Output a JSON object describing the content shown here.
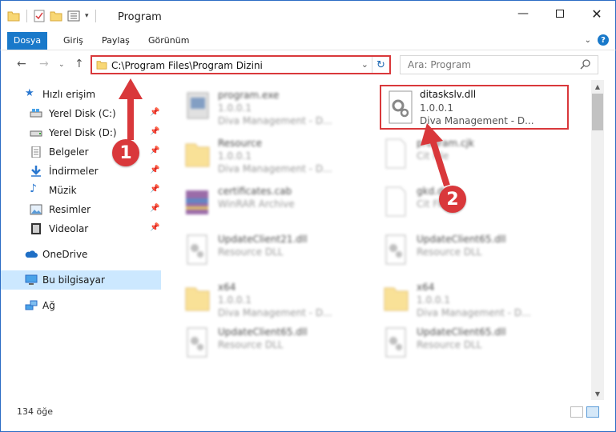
{
  "window": {
    "title": "Program",
    "minimize_icon": "minimize-icon",
    "maximize_icon": "maximize-icon",
    "close_icon": "close-icon"
  },
  "ribbon": {
    "tabs": [
      "Dosya",
      "Giriş",
      "Paylaş",
      "Görünüm"
    ],
    "file_tab_color": "#1979ca"
  },
  "address": {
    "path": "C:\\Program Files\\Program Dizini"
  },
  "search": {
    "placeholder": "Ara: Program"
  },
  "sidebar": {
    "items": [
      {
        "label": "Hızlı erişim",
        "icon": "star-icon",
        "pinned": false
      },
      {
        "label": "Yerel Disk (C:)",
        "icon": "drive-icon",
        "pinned": true
      },
      {
        "label": "Yerel Disk (D:)",
        "icon": "drive-icon",
        "pinned": true
      },
      {
        "label": "Belgeler",
        "icon": "document-icon",
        "pinned": true
      },
      {
        "label": "İndirmeler",
        "icon": "download-icon",
        "pinned": true
      },
      {
        "label": "Müzik",
        "icon": "music-icon",
        "pinned": true
      },
      {
        "label": "Resimler",
        "icon": "pictures-icon",
        "pinned": true
      },
      {
        "label": "Videolar",
        "icon": "video-icon",
        "pinned": true
      },
      {
        "label": "OneDrive",
        "icon": "cloud-icon",
        "pinned": false
      },
      {
        "label": "Bu bilgisayar",
        "icon": "computer-icon",
        "pinned": false,
        "selected": true
      },
      {
        "label": "Ağ",
        "icon": "network-icon",
        "pinned": false
      }
    ]
  },
  "files": [
    {
      "name": "program.exe",
      "line1": "1.0.0.1",
      "line2": "Diva Management - D...",
      "icon": "exe-icon"
    },
    {
      "name": "ditaskslv.dll",
      "line1": "1.0.0.1",
      "line2": "Diva Management - D...",
      "icon": "dll-gear-icon",
      "highlighted": true
    },
    {
      "name": "Resource",
      "line1": "1.0.0.1",
      "line2": "Diva Management - D...",
      "icon": "folder-icon"
    },
    {
      "name": "program.cjk",
      "line1": "Cit File",
      "line2": "",
      "icon": "blank-file-icon"
    },
    {
      "name": "certificates.cab",
      "line1": "WinRAR Archive",
      "line2": "",
      "icon": "archive-icon"
    },
    {
      "name": "gkd.dat",
      "line1": "Cit File",
      "line2": "",
      "icon": "blank-file-icon"
    },
    {
      "name": "UpdateClient21.dll",
      "line1": "Resource DLL",
      "line2": "",
      "icon": "dll-gear-icon"
    },
    {
      "name": "UpdateClient65.dll",
      "line1": "Resource DLL",
      "line2": "",
      "icon": "dll-gear-icon"
    },
    {
      "name": "x64",
      "line1": "1.0.0.1",
      "line2": "Diva Management - D...",
      "icon": "folder-icon"
    },
    {
      "name": "x64",
      "line1": "1.0.0.1",
      "line2": "Diva Management - D...",
      "icon": "folder-icon"
    },
    {
      "name": "UpdateClient65.dll",
      "line1": "Resource DLL",
      "line2": "",
      "icon": "dll-gear-icon"
    },
    {
      "name": "UpdateClient65.dll",
      "line1": "Resource DLL",
      "line2": "",
      "icon": "dll-gear-icon"
    }
  ],
  "status": {
    "item_count": "134 öğe"
  },
  "annotations": {
    "step1": "1",
    "step2": "2",
    "highlight_color": "#d9383b"
  }
}
